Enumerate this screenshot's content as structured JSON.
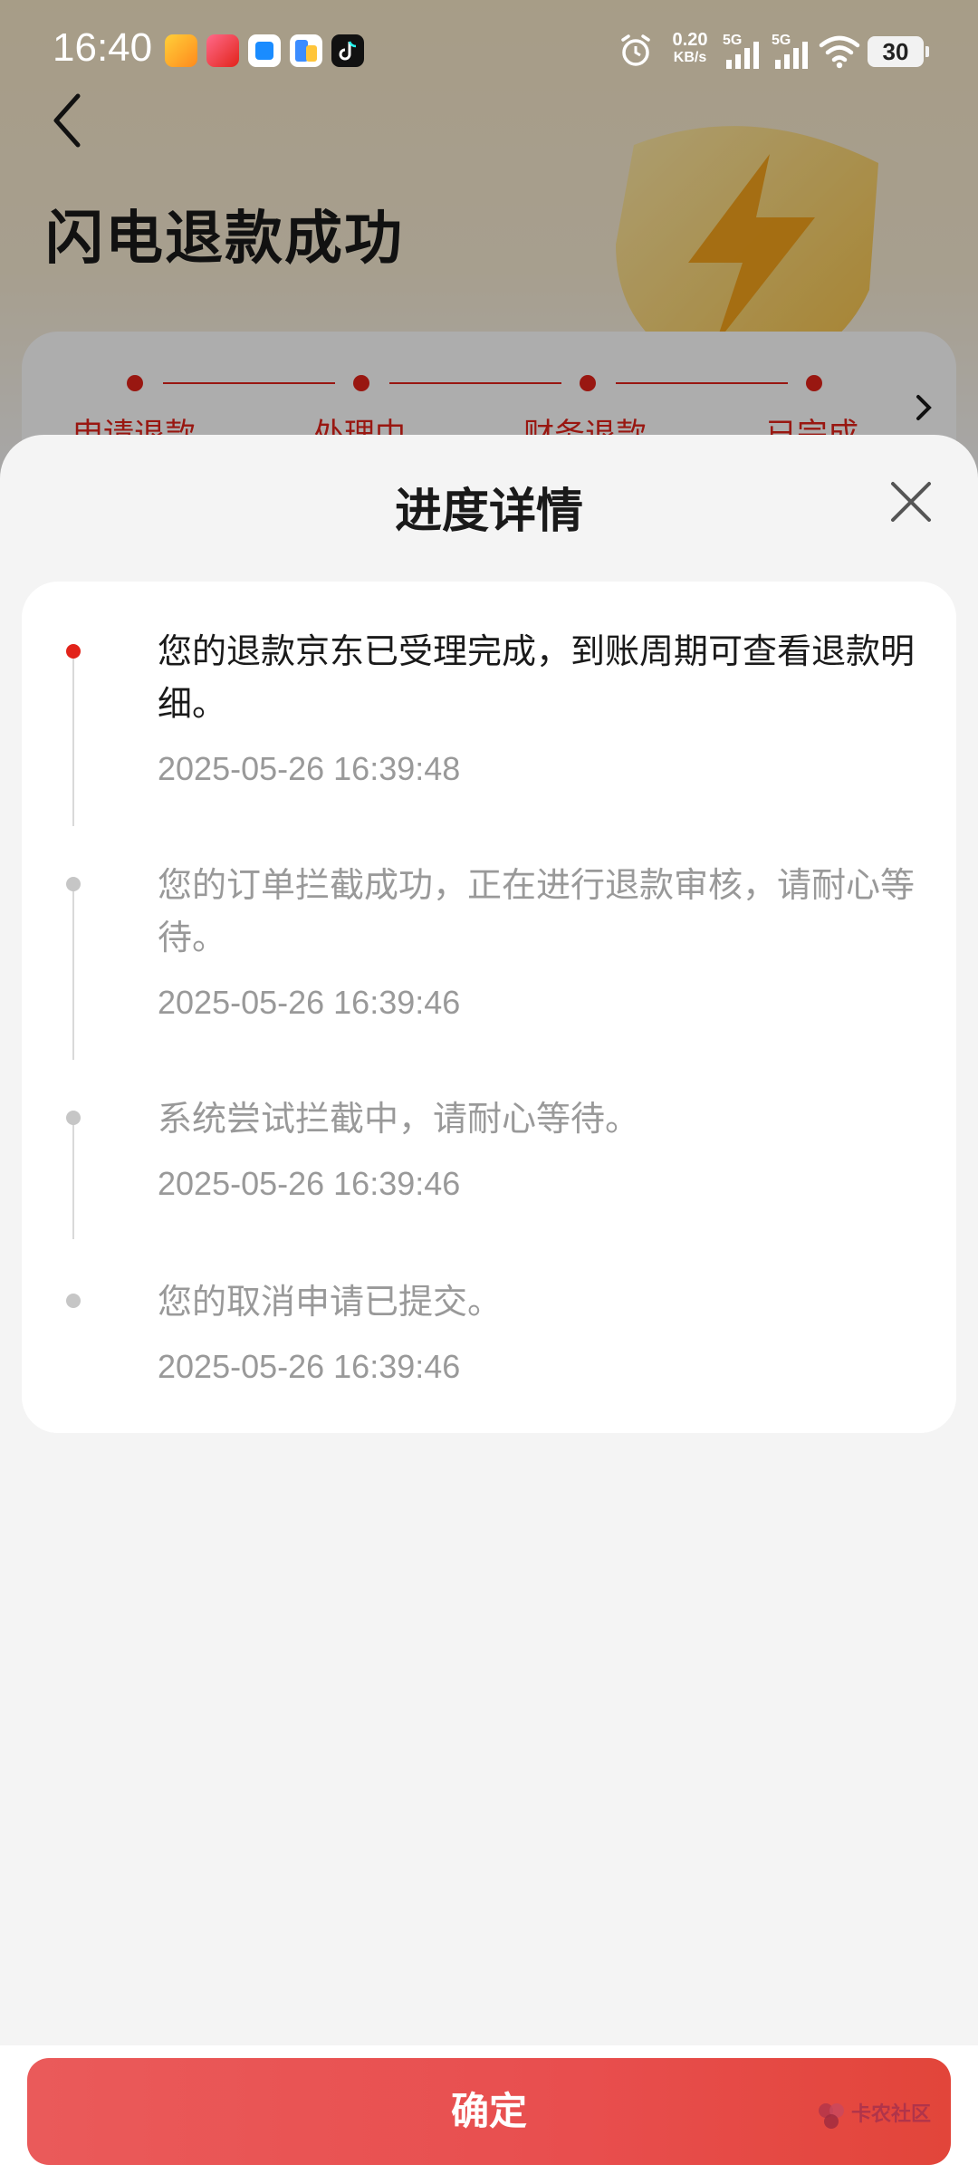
{
  "status_bar": {
    "time": "16:40",
    "net_speed_value": "0.20",
    "net_speed_unit": "KB/s",
    "sim1": "5G",
    "sim2": "5G",
    "battery": "30",
    "icons": [
      "video-app-icon",
      "shopping-618-app-icon",
      "blue-app-icon",
      "file-app-icon",
      "tiktok-icon",
      "alarm-icon",
      "signal-icon",
      "signal-icon",
      "wifi-icon",
      "battery-icon"
    ]
  },
  "background_page": {
    "title": "闪电退款成功",
    "steps": [
      "申请退款",
      "处理中",
      "财务退款",
      "已完成"
    ]
  },
  "sheet": {
    "title": "进度详情",
    "timeline": [
      {
        "text": "您的退款京东已受理完成，到账周期可查看退款明细。",
        "time": "2025-05-26 16:39:48",
        "active": true
      },
      {
        "text": "您的订单拦截成功，正在进行退款审核，请耐心等待。",
        "time": "2025-05-26 16:39:46",
        "active": false
      },
      {
        "text": "系统尝试拦截中，请耐心等待。",
        "time": "2025-05-26 16:39:46",
        "active": false
      },
      {
        "text": "您的取消申请已提交。",
        "time": "2025-05-26 16:39:46",
        "active": false
      }
    ]
  },
  "footer": {
    "confirm_label": "确定",
    "watermark": "卡农社区"
  },
  "colors": {
    "accent": "#e2231a",
    "button": "#e84e4e",
    "muted_text": "#999999"
  }
}
